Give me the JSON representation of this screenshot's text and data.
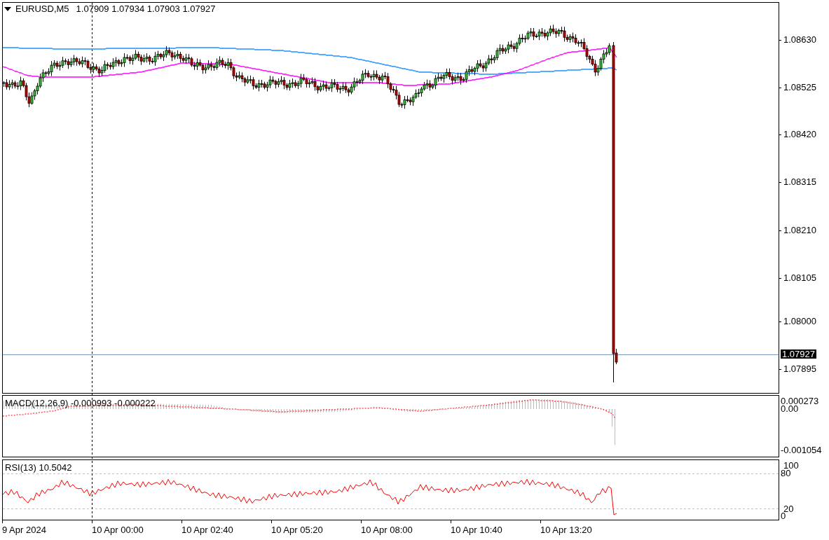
{
  "header": {
    "symbol": "EURUSD,M5",
    "ohlc": "1.07909 1.07934 1.07903 1.07927"
  },
  "price_axis": {
    "labels": [
      "1.08630",
      "1.08525",
      "1.08420",
      "1.08315",
      "1.08210",
      "1.08105",
      "1.08000",
      "1.07895"
    ],
    "current_price": "1.07927"
  },
  "macd": {
    "title": "MACD(12,26,9) -0.000993 -0.000222",
    "axis_labels": [
      "0.000273",
      "0.00",
      "-0.001054"
    ]
  },
  "rsi": {
    "title": "RSI(13) 10.5042",
    "axis_labels": [
      "100",
      "80",
      "20",
      "0"
    ]
  },
  "time_axis": {
    "labels": [
      "9 Apr 2024",
      "10 Apr 00:00",
      "10 Apr 02:40",
      "10 Apr 05:20",
      "10 Apr 08:00",
      "10 Apr 10:40",
      "10 Apr 13:20"
    ]
  }
}
